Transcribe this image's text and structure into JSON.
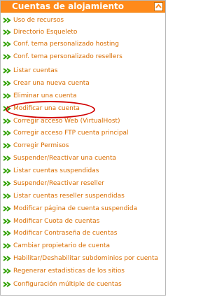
{
  "panel": {
    "title": "Cuentas de alojamiento",
    "icons": {
      "collapse": "collapse-arrow-icon",
      "bullet": "double-chevron-icon"
    },
    "colors": {
      "header": "#ff8a1a",
      "link": "#d96d00",
      "bullet": "#2fa000",
      "highlight": "#d10000"
    },
    "items": [
      {
        "label": "Uso de recursos"
      },
      {
        "label": "Directorio Esqueleto"
      },
      {
        "label": "Conf. tema personalizado hosting"
      },
      {
        "label": "Conf. tema personalizado resellers"
      },
      {
        "label": "Listar cuentas"
      },
      {
        "label": "Crear una nueva cuenta"
      },
      {
        "label": "Eliminar una cuenta"
      },
      {
        "label": "Modificar una cuenta"
      },
      {
        "label": "Corregir acceso Web (VirtualHost)"
      },
      {
        "label": "Corregir acceso FTP cuenta principal"
      },
      {
        "label": "Corregir Permisos"
      },
      {
        "label": "Suspender/Reactivar una cuenta"
      },
      {
        "label": "Listar cuentas suspendidas"
      },
      {
        "label": "Suspender/Reactivar reseller"
      },
      {
        "label": "Listar cuentas reseller suspendidas"
      },
      {
        "label": "Modificar página de cuenta suspendida"
      },
      {
        "label": "Modificar Cuota de cuentas"
      },
      {
        "label": "Modificar Contraseña de cuentas"
      },
      {
        "label": "Cambiar propietario de cuenta"
      },
      {
        "label": "Habilitar/Deshabilitar subdominios por cuenta"
      },
      {
        "label": "Regenerar estadisticas de los sitios"
      },
      {
        "label": "Configuración múltiple de cuentas"
      }
    ]
  }
}
